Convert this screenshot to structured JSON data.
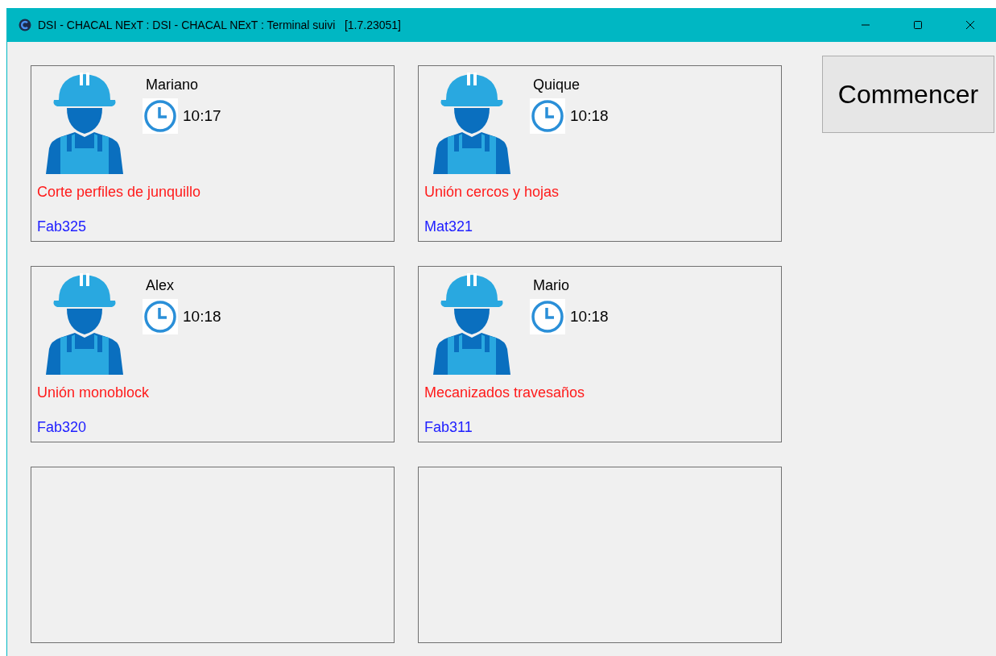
{
  "window": {
    "title": "DSI - CHACAL NExT : DSI - CHACAL NExT : Terminal suivi   [1.7.23051]"
  },
  "cards": [
    {
      "kind": "worker",
      "name": "Mariano",
      "time": "10:17",
      "task": "Corte perfiles de junquillo",
      "code": "Fab325"
    },
    {
      "kind": "worker",
      "name": "Quique",
      "time": "10:18",
      "task": "Unión cercos y hojas",
      "code": "Mat321"
    },
    {
      "kind": "worker",
      "name": "Alex",
      "time": "10:18",
      "task": "Unión monoblock",
      "code": "Fab320"
    },
    {
      "kind": "worker",
      "name": "Mario",
      "time": "10:18",
      "task": "Mecanizados travesaños",
      "code": "Fab311"
    },
    {
      "kind": "empty"
    },
    {
      "kind": "empty"
    }
  ],
  "button": "Commencer"
}
